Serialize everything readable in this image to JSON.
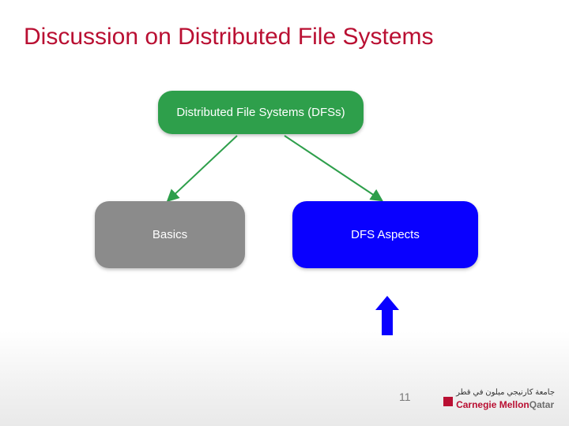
{
  "title": "Discussion on Distributed File Systems",
  "nodes": {
    "root": "Distributed File Systems (DFSs)",
    "left": "Basics",
    "right": "DFS Aspects"
  },
  "page_number": "11",
  "logo": {
    "arabic": "جامعة كارنيجي ميلون في قطر",
    "line1": "Carnegie Mellon",
    "line2": "Qatar"
  },
  "colors": {
    "accent": "#b90f32",
    "root_node": "#2e9f4b",
    "left_node": "#8b8b8b",
    "right_node": "#0900ff",
    "arrow": "#0900ff"
  }
}
